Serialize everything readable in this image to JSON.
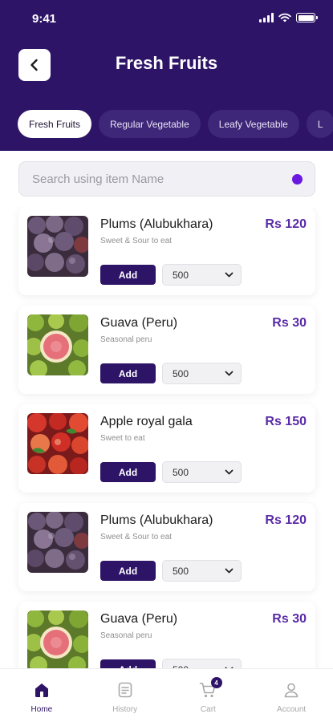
{
  "status_bar": {
    "time": "9:41"
  },
  "header": {
    "title": "Fresh Fruits"
  },
  "categories": [
    {
      "label": "Fresh Fruits",
      "active": true
    },
    {
      "label": "Regular Vegetable",
      "active": false
    },
    {
      "label": "Leafy Vegetable",
      "active": false
    },
    {
      "label": "L",
      "active": false
    }
  ],
  "search": {
    "placeholder": "Search using item Name"
  },
  "products": [
    {
      "name": "Plums (Alubukhara)",
      "description": "Sweet & Sour to eat",
      "price": "Rs 120",
      "add_label": "Add",
      "qty": "500",
      "image": "plums"
    },
    {
      "name": "Guava (Peru)",
      "description": "Seasonal peru",
      "price": "Rs 30",
      "add_label": "Add",
      "qty": "500",
      "image": "guava"
    },
    {
      "name": "Apple royal gala",
      "description": "Sweet to eat",
      "price": "Rs 150",
      "add_label": "Add",
      "qty": "500",
      "image": "apple"
    },
    {
      "name": "Plums (Alubukhara)",
      "description": "Sweet & Sour to eat",
      "price": "Rs 120",
      "add_label": "Add",
      "qty": "500",
      "image": "plums"
    },
    {
      "name": "Guava (Peru)",
      "description": "Seasonal peru",
      "price": "Rs 30",
      "add_label": "Add",
      "qty": "500",
      "image": "guava"
    }
  ],
  "tabbar": {
    "items": [
      {
        "label": "Home",
        "icon": "home-icon",
        "active": true
      },
      {
        "label": "History",
        "icon": "history-icon",
        "active": false
      },
      {
        "label": "Cart",
        "icon": "cart-icon",
        "active": false
      },
      {
        "label": "Account",
        "icon": "account-icon",
        "active": false
      }
    ],
    "cart_count": "4"
  },
  "colors": {
    "primary": "#2d1467",
    "price": "#5a2aa7",
    "search_dot": "#6a19e0"
  }
}
